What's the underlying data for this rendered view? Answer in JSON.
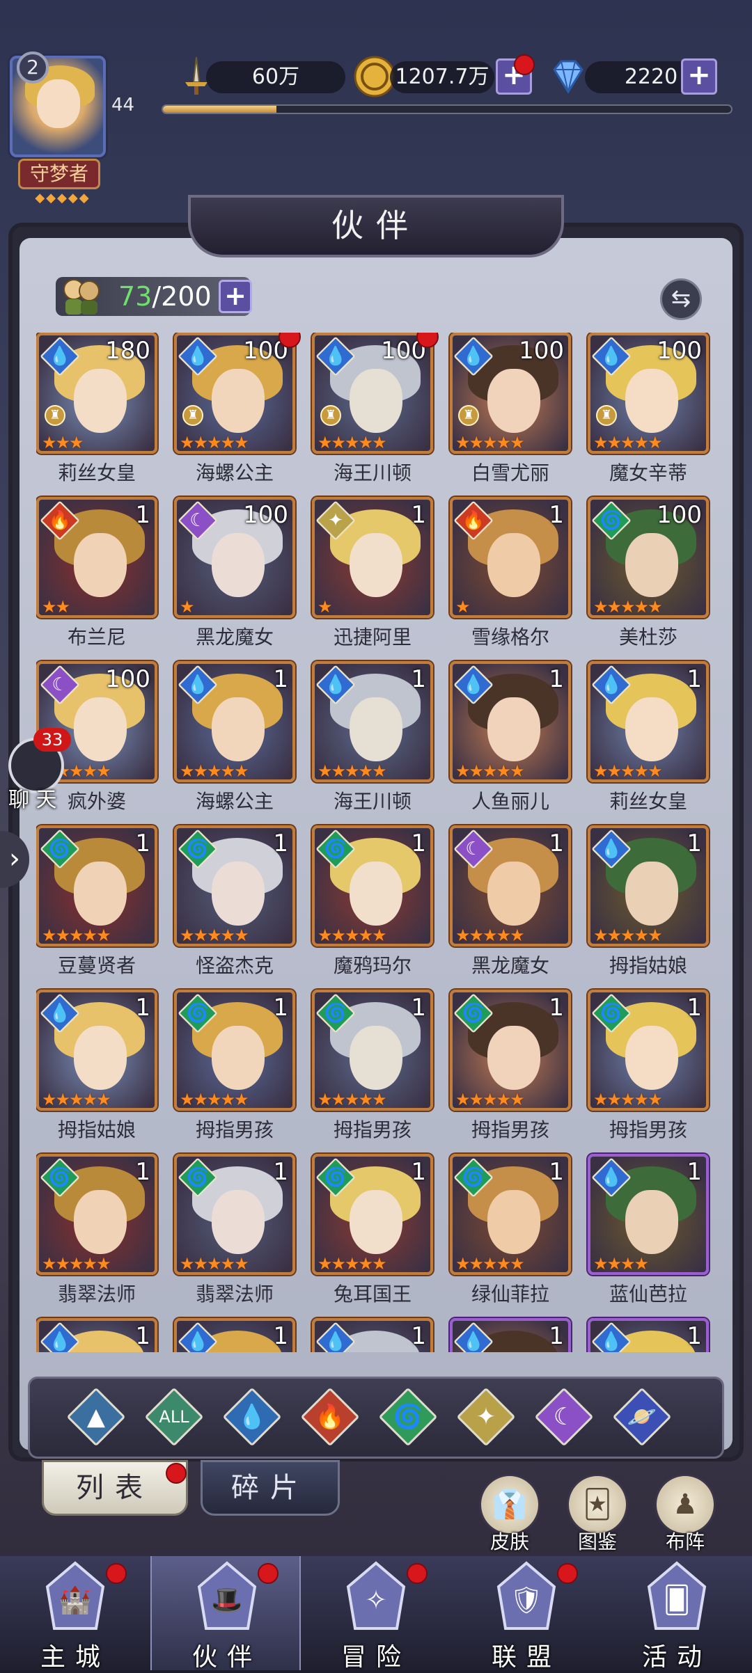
{
  "player": {
    "level_badge": "2",
    "level": "44",
    "title": "守梦者",
    "title_stars": "◆◆◆◆◆",
    "xp_progress": 0.2
  },
  "resources": {
    "power": "60万",
    "gold": "1207.7万",
    "gems": "2220",
    "plus": "+"
  },
  "panel": {
    "title": "伙伴",
    "count_current": "73",
    "count_max": "/200",
    "plus": "+",
    "swap_icon": "⇆"
  },
  "chat": {
    "badge": "33",
    "label": "聊 天"
  },
  "companions": [
    {
      "name": "莉丝女皇",
      "level": "180",
      "element": "water",
      "stars": "★★★",
      "crest": true,
      "dot": false
    },
    {
      "name": "海螺公主",
      "level": "100",
      "element": "water",
      "stars": "★★★★★",
      "crest": true,
      "dot": true
    },
    {
      "name": "海王川顿",
      "level": "100",
      "element": "water",
      "stars": "★★★★★",
      "crest": true,
      "dot": true
    },
    {
      "name": "白雪尤丽",
      "level": "100",
      "element": "water",
      "stars": "★★★★★",
      "crest": true,
      "dot": false
    },
    {
      "name": "魔女辛蒂",
      "level": "100",
      "element": "water",
      "stars": "★★★★★",
      "crest": true,
      "dot": false
    },
    {
      "name": "布兰尼",
      "level": "1",
      "element": "fire",
      "stars": "★★",
      "crest": false,
      "dot": false
    },
    {
      "name": "黑龙魔女",
      "level": "100",
      "element": "dark",
      "stars": "★",
      "crest": false,
      "dot": false
    },
    {
      "name": "迅捷阿里",
      "level": "1",
      "element": "light",
      "stars": "★",
      "crest": false,
      "dot": false
    },
    {
      "name": "雪缘格尔",
      "level": "1",
      "element": "fire",
      "stars": "★",
      "crest": false,
      "dot": false
    },
    {
      "name": "美杜莎",
      "level": "100",
      "element": "wind",
      "stars": "★★★★★",
      "crest": false,
      "dot": false
    },
    {
      "name": "疯外婆",
      "level": "100",
      "element": "dark",
      "stars": "★★★★★",
      "crest": false,
      "dot": false
    },
    {
      "name": "海螺公主",
      "level": "1",
      "element": "water",
      "stars": "★★★★★",
      "crest": false,
      "dot": false
    },
    {
      "name": "海王川顿",
      "level": "1",
      "element": "water",
      "stars": "★★★★★",
      "crest": false,
      "dot": false
    },
    {
      "name": "人鱼丽儿",
      "level": "1",
      "element": "water",
      "stars": "★★★★★",
      "crest": false,
      "dot": false
    },
    {
      "name": "莉丝女皇",
      "level": "1",
      "element": "water",
      "stars": "★★★★★",
      "crest": false,
      "dot": false
    },
    {
      "name": "豆蔓贤者",
      "level": "1",
      "element": "wind",
      "stars": "★★★★★",
      "crest": false,
      "dot": false
    },
    {
      "name": "怪盗杰克",
      "level": "1",
      "element": "wind",
      "stars": "★★★★★",
      "crest": false,
      "dot": false
    },
    {
      "name": "魔鸦玛尔",
      "level": "1",
      "element": "wind",
      "stars": "★★★★★",
      "crest": false,
      "dot": false
    },
    {
      "name": "黑龙魔女",
      "level": "1",
      "element": "dark",
      "stars": "★★★★★",
      "crest": false,
      "dot": false
    },
    {
      "name": "拇指姑娘",
      "level": "1",
      "element": "water",
      "stars": "★★★★★",
      "crest": false,
      "dot": false
    },
    {
      "name": "拇指姑娘",
      "level": "1",
      "element": "water",
      "stars": "★★★★★",
      "crest": false,
      "dot": false
    },
    {
      "name": "拇指男孩",
      "level": "1",
      "element": "wind",
      "stars": "★★★★★",
      "crest": false,
      "dot": false
    },
    {
      "name": "拇指男孩",
      "level": "1",
      "element": "wind",
      "stars": "★★★★★",
      "crest": false,
      "dot": false
    },
    {
      "name": "拇指男孩",
      "level": "1",
      "element": "wind",
      "stars": "★★★★★",
      "crest": false,
      "dot": false
    },
    {
      "name": "拇指男孩",
      "level": "1",
      "element": "wind",
      "stars": "★★★★★",
      "crest": false,
      "dot": false
    },
    {
      "name": "翡翠法师",
      "level": "1",
      "element": "wind",
      "stars": "★★★★★",
      "crest": false,
      "dot": false
    },
    {
      "name": "翡翠法师",
      "level": "1",
      "element": "wind",
      "stars": "★★★★★",
      "crest": false,
      "dot": false
    },
    {
      "name": "兔耳国王",
      "level": "1",
      "element": "wind",
      "stars": "★★★★★",
      "crest": false,
      "dot": false
    },
    {
      "name": "绿仙菲拉",
      "level": "1",
      "element": "wind",
      "stars": "★★★★★",
      "crest": false,
      "dot": false
    },
    {
      "name": "蓝仙芭拉",
      "level": "1",
      "element": "water",
      "stars": "★★★★",
      "crest": false,
      "dot": false,
      "purple": true
    },
    {
      "name": "",
      "level": "1",
      "element": "water",
      "stars": "",
      "crest": false,
      "dot": false
    },
    {
      "name": "",
      "level": "1",
      "element": "water",
      "stars": "",
      "crest": false,
      "dot": false
    },
    {
      "name": "",
      "level": "1",
      "element": "water",
      "stars": "",
      "crest": false,
      "dot": false
    },
    {
      "name": "",
      "level": "1",
      "element": "water",
      "stars": "",
      "crest": false,
      "dot": false,
      "purple": true
    },
    {
      "name": "",
      "level": "1",
      "element": "water",
      "stars": "",
      "crest": false,
      "dot": false,
      "purple": true
    }
  ],
  "filters": [
    {
      "name": "filter-all-elements-icon",
      "glyph": "▲",
      "color": "#3a6fa0"
    },
    {
      "name": "filter-all",
      "glyph": "ALL",
      "color": "#3c8a6b"
    },
    {
      "name": "filter-water-icon",
      "glyph": "💧",
      "color": "#2f6bb3"
    },
    {
      "name": "filter-fire-icon",
      "glyph": "🔥",
      "color": "#b8402c"
    },
    {
      "name": "filter-wind-icon",
      "glyph": "🌀",
      "color": "#2f9a5a"
    },
    {
      "name": "filter-light-icon",
      "glyph": "✦",
      "color": "#b9a14a"
    },
    {
      "name": "filter-dark-icon",
      "glyph": "☾",
      "color": "#8b4fc6"
    },
    {
      "name": "filter-planet-icon",
      "glyph": "🪐",
      "color": "#3b4fb5"
    }
  ],
  "tabs": {
    "list": "列表",
    "fragments": "碎片"
  },
  "side_buttons": [
    {
      "label": "皮肤",
      "glyph": "👔"
    },
    {
      "label": "图鉴",
      "glyph": "🃏"
    },
    {
      "label": "布阵",
      "glyph": "♟"
    }
  ],
  "bottom_nav": [
    {
      "label": "主城",
      "glyph": "🏰",
      "dot": true
    },
    {
      "label": "伙伴",
      "glyph": "🎩",
      "dot": true,
      "active": true
    },
    {
      "label": "冒险",
      "glyph": "✧",
      "dot": true
    },
    {
      "label": "联盟",
      "glyph": "🛡",
      "dot": true
    },
    {
      "label": "活动",
      "glyph": "🂠",
      "dot": false
    }
  ],
  "colors": {
    "water": "#2f6bd0",
    "fire": "#cc3a22",
    "wind": "#1f9b5a",
    "light": "#b9a24a",
    "dark": "#8b4fc6"
  }
}
